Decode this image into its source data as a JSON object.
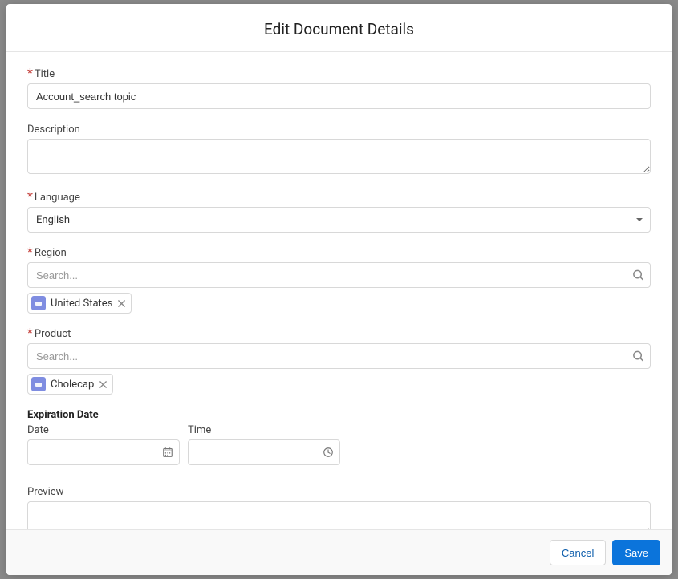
{
  "modal": {
    "title": "Edit Document Details"
  },
  "fields": {
    "title": {
      "label": "Title",
      "value": "Account_search topic"
    },
    "description": {
      "label": "Description",
      "value": ""
    },
    "language": {
      "label": "Language",
      "value": "English"
    },
    "region": {
      "label": "Region",
      "placeholder": "Search...",
      "tag": "United States"
    },
    "product": {
      "label": "Product",
      "placeholder": "Search...",
      "tag": "Cholecap"
    },
    "expiration": {
      "label": "Expiration Date",
      "date_label": "Date",
      "time_label": "Time"
    },
    "preview": {
      "label": "Preview",
      "value": ""
    }
  },
  "footer": {
    "cancel": "Cancel",
    "save": "Save"
  }
}
